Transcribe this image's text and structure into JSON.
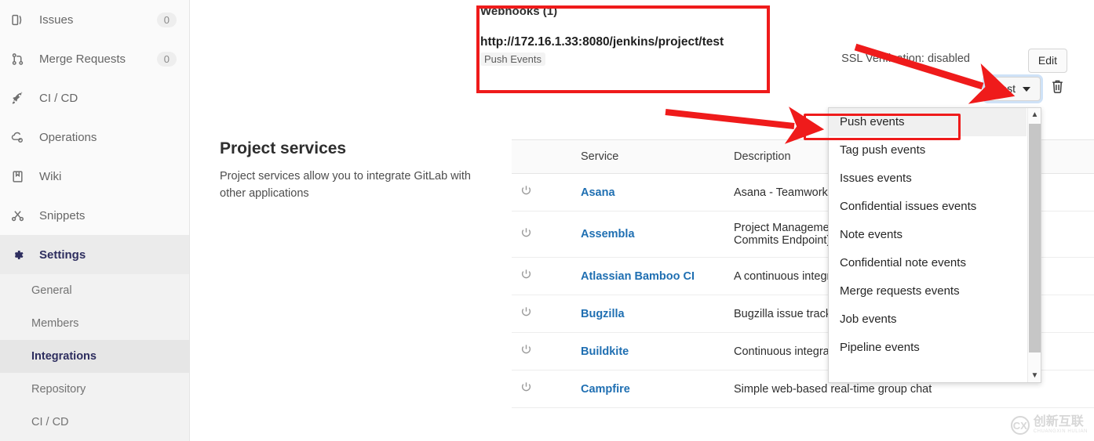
{
  "sidebar": {
    "items": [
      {
        "label": "Issues",
        "icon": "issues-icon",
        "badge": "0"
      },
      {
        "label": "Merge Requests",
        "icon": "merge-request-icon",
        "badge": "0"
      },
      {
        "label": "CI / CD",
        "icon": "rocket-icon",
        "badge": ""
      },
      {
        "label": "Operations",
        "icon": "cloud-gear-icon",
        "badge": ""
      },
      {
        "label": "Wiki",
        "icon": "book-icon",
        "badge": ""
      },
      {
        "label": "Snippets",
        "icon": "scissors-icon",
        "badge": ""
      },
      {
        "label": "Settings",
        "icon": "gear-icon",
        "badge": ""
      }
    ],
    "subnav": [
      {
        "label": "General",
        "active": false
      },
      {
        "label": "Members",
        "active": false
      },
      {
        "label": "Integrations",
        "active": true
      },
      {
        "label": "Repository",
        "active": false
      },
      {
        "label": "CI / CD",
        "active": false
      }
    ],
    "active_section": "Settings",
    "active_item": "Integrations"
  },
  "webhook": {
    "title": "Webhooks (1)",
    "url": "http://172.16.1.33:8080/jenkins/project/test",
    "events_badge": "Push Events",
    "ssl_note": "SSL Verification: disabled",
    "edit_label": "Edit",
    "test_label": "Test",
    "delete_icon": "trash-icon"
  },
  "dropdown": {
    "items": [
      "Push events",
      "Tag push events",
      "Issues events",
      "Confidential issues events",
      "Note events",
      "Confidential note events",
      "Merge requests events",
      "Job events",
      "Pipeline events"
    ],
    "highlighted": "Push events",
    "scroll_up_icon": "chevron-up-icon",
    "scroll_down_icon": "chevron-down-icon"
  },
  "services": {
    "title": "Project services",
    "description": "Project services allow you to integrate GitLab with other applications",
    "columns": [
      "",
      "Service",
      "Description"
    ],
    "rows": [
      {
        "icon": "power-icon",
        "name": "Asana",
        "description": "Asana - Teamwork wit"
      },
      {
        "icon": "power-icon",
        "name": "Assembla",
        "description": "Project Management\nCommits Endpoint)"
      },
      {
        "icon": "power-icon",
        "name": "Atlassian Bamboo CI",
        "description": "A continuous integrat"
      },
      {
        "icon": "power-icon",
        "name": "Bugzilla",
        "description": "Bugzilla issue tracker"
      },
      {
        "icon": "power-icon",
        "name": "Buildkite",
        "description": "Continuous integratio"
      },
      {
        "icon": "power-icon",
        "name": "Campfire",
        "description": "Simple web-based real-time group chat"
      }
    ]
  },
  "annotations": {
    "highlight_color": "#ef1b1b",
    "boxes": [
      "webhook-panel",
      "push-events-item"
    ],
    "arrows": [
      "arrow-to-test-button",
      "arrow-to-push-events"
    ]
  },
  "watermark": {
    "cn": "创新互联",
    "en": "CHUANGXIN HULIAN",
    "mark": "CX"
  }
}
